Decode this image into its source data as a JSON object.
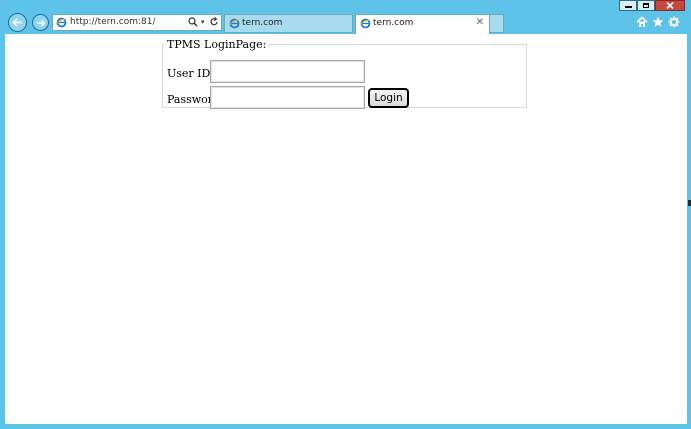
{
  "browser": {
    "address_url": "http://tern.com:81/",
    "tabs": [
      {
        "label": "tern.com",
        "active": false
      },
      {
        "label": "tern.com",
        "active": true
      }
    ],
    "colors": {
      "frame": "#5ec3e9",
      "close": "#c7483e"
    }
  },
  "login": {
    "legend": "TPMS LoginPage:",
    "user_label": "User ID",
    "user_value": "",
    "password_label": "Password",
    "password_value": "",
    "login_button": "Login"
  }
}
